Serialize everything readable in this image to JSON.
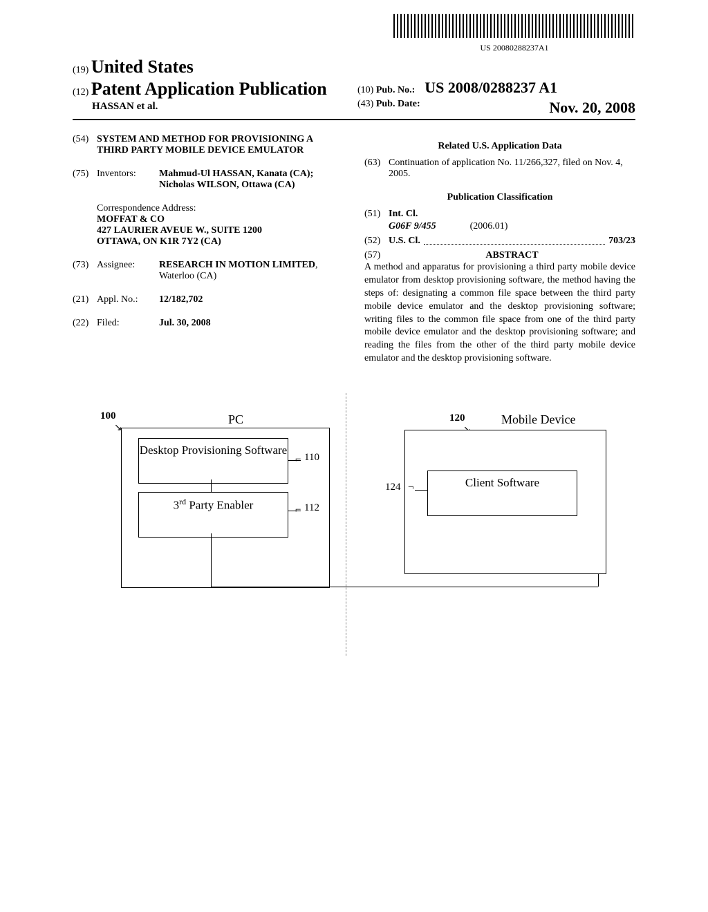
{
  "barcode_text": "US 20080288237A1",
  "header": {
    "code19": "(19)",
    "country": "United States",
    "code12": "(12)",
    "doc_type": "Patent Application Publication",
    "authors": "HASSAN et al.",
    "code10": "(10)",
    "pub_no_label": "Pub. No.:",
    "pub_no": "US 2008/0288237 A1",
    "code43": "(43)",
    "pub_date_label": "Pub. Date:",
    "pub_date": "Nov. 20, 2008"
  },
  "left_col": {
    "code54": "(54)",
    "title": "SYSTEM AND METHOD FOR PROVISIONING A THIRD PARTY MOBILE DEVICE EMULATOR",
    "code75": "(75)",
    "inventors_label": "Inventors:",
    "inventors_value": "Mahmud-Ul HASSAN, Kanata (CA); Nicholas WILSON, Ottawa (CA)",
    "correspondence_label": "Correspondence Address:",
    "correspondence_name": "MOFFAT & CO",
    "correspondence_addr1": "427 LAURIER AVEUE W., SUITE 1200",
    "correspondence_addr2": "OTTAWA, ON K1R 7Y2 (CA)",
    "code73": "(73)",
    "assignee_label": "Assignee:",
    "assignee_value_bold": "RESEARCH IN MOTION LIMITED",
    "assignee_value_rest": ", Waterloo (CA)",
    "code21": "(21)",
    "appl_no_label": "Appl. No.:",
    "appl_no": "12/182,702",
    "code22": "(22)",
    "filed_label": "Filed:",
    "filed": "Jul. 30, 2008"
  },
  "right_col": {
    "related_head": "Related U.S. Application Data",
    "code63": "(63)",
    "continuation": "Continuation of application No. 11/266,327, filed on Nov. 4, 2005.",
    "classification_head": "Publication Classification",
    "code51": "(51)",
    "intcl_label": "Int. Cl.",
    "intcl_code": "G06F 9/455",
    "intcl_date": "(2006.01)",
    "code52": "(52)",
    "uscl_label": "U.S. Cl.",
    "uscl_value": "703/23",
    "code57": "(57)",
    "abstract_head": "ABSTRACT",
    "abstract_text": "A method and apparatus for provisioning a third party mobile device emulator from desktop provisioning software, the method having the steps of: designating a common file space between the third party mobile device emulator and the desktop provisioning software; writing files to the common file space from one of the third party mobile device emulator and the desktop provisioning software; and reading the files from the other of the third party mobile device emulator and the desktop provisioning software."
  },
  "figure": {
    "ref100": "100",
    "pc_label": "PC",
    "box110": "Desktop Provisioning Software",
    "ref110": "110",
    "box112_prefix": "3",
    "box112_sup": "rd",
    "box112_suffix": " Party Enabler",
    "ref112": "112",
    "ref120": "120",
    "mobile_label": "Mobile Device",
    "ref124": "124",
    "box124": "Client Software"
  }
}
